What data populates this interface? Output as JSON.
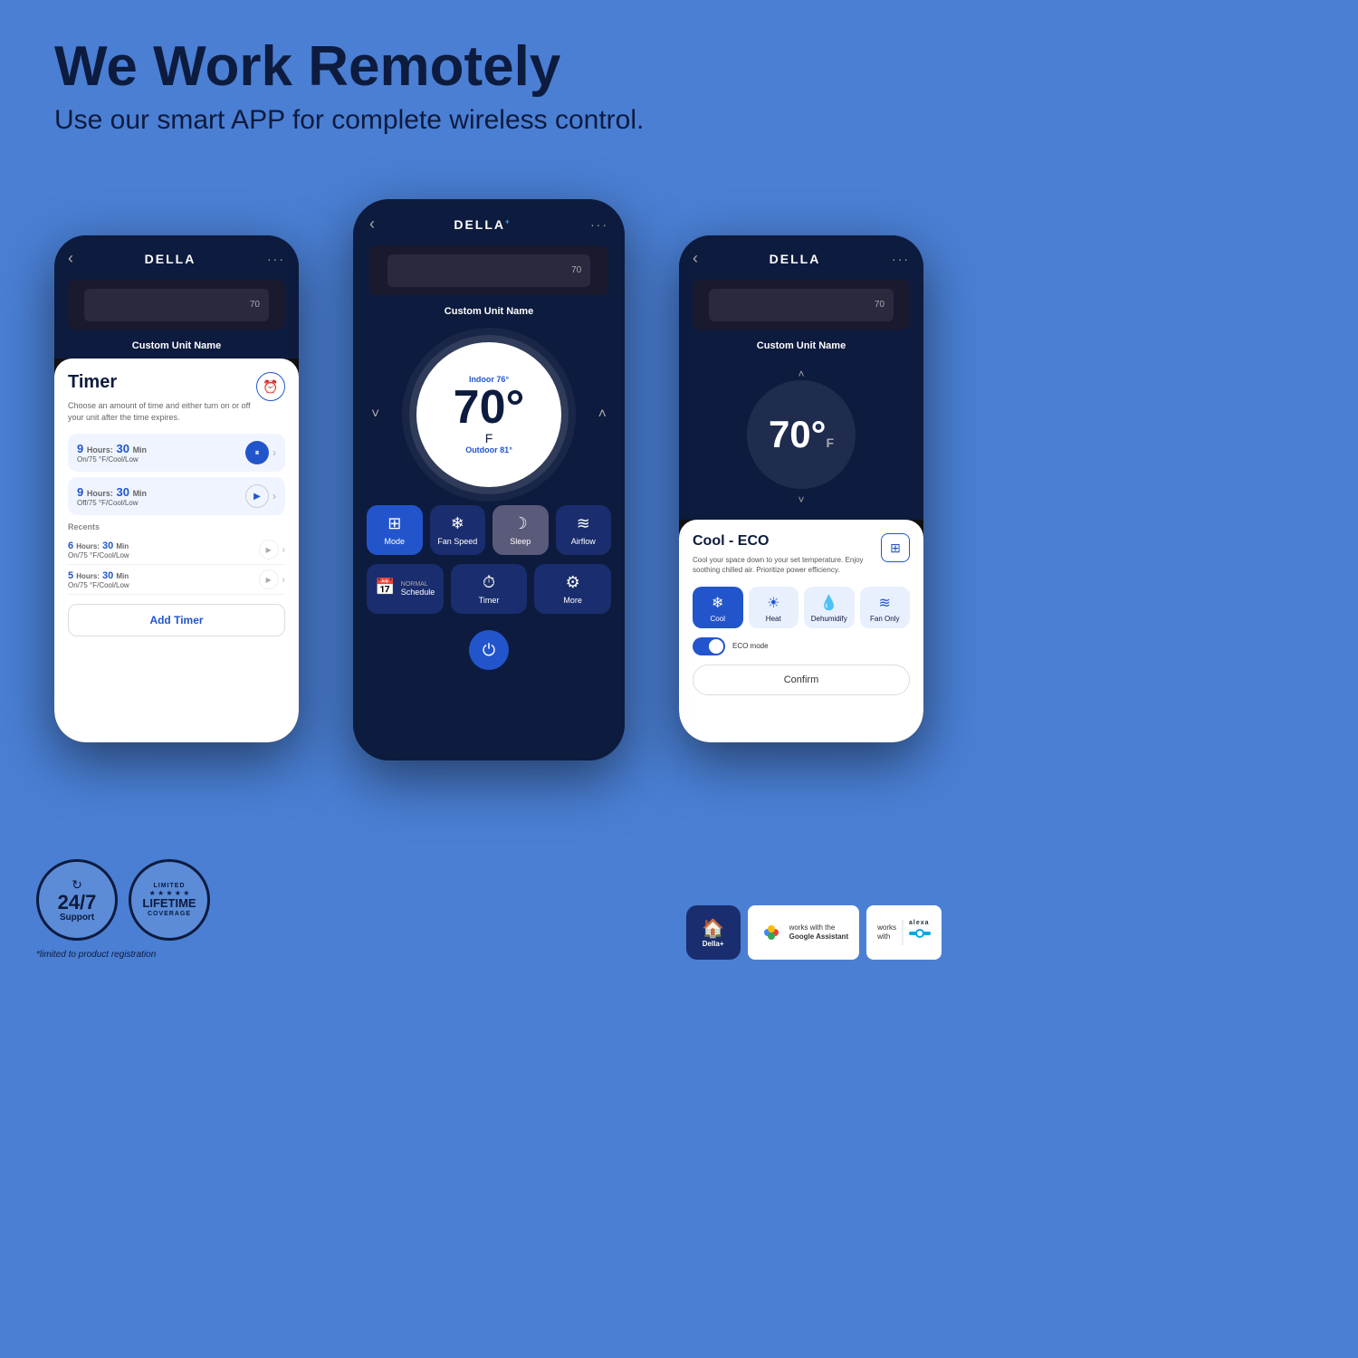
{
  "header": {
    "title": "We Work Remotely",
    "subtitle": "Use our smart APP for complete wireless control."
  },
  "left_phone": {
    "brand": "DELLA",
    "unit_name": "Custom Unit Name",
    "screen": "timer",
    "timer_title": "Timer",
    "timer_desc": "Choose an amount of time and either turn on or off your unit after the time expires.",
    "timers": [
      {
        "hours": "9",
        "hours_label": "Hours:",
        "mins": "30",
        "mins_label": "Min",
        "sub": "On/75 °F/Cool/Low",
        "active": true
      },
      {
        "hours": "9",
        "hours_label": "Hours:",
        "mins": "30",
        "mins_label": "Min",
        "sub": "Off/75 °F/Cool/Low",
        "active": false
      }
    ],
    "recents_label": "Recents",
    "recents": [
      {
        "hours": "6",
        "hours_label": "Hours:",
        "mins": "30",
        "mins_label": "Min",
        "sub": "On/75 °F/Cool/Low"
      },
      {
        "hours": "5",
        "hours_label": "Hours:",
        "mins": "30",
        "mins_label": "Min",
        "sub": "On/75 °F/Cool/Low"
      }
    ],
    "add_timer_label": "Add Timer"
  },
  "center_phone": {
    "brand": "DELLA",
    "unit_name": "Custom Unit Name",
    "indoor_label": "Indoor 76°",
    "temp": "70°",
    "temp_unit": "F",
    "outdoor_label": "Outdoor 81°",
    "modes": [
      {
        "label": "Mode",
        "icon": "⊞"
      },
      {
        "label": "Fan Speed",
        "icon": "❄"
      },
      {
        "label": "Sleep",
        "icon": "☾"
      },
      {
        "label": "Airflow",
        "icon": "≋"
      }
    ],
    "bottom_buttons": [
      {
        "label": "Schedule",
        "sublabel": "NORMAL",
        "icon": "📅"
      },
      {
        "label": "Timer",
        "icon": "⏱"
      },
      {
        "label": "More",
        "icon": "⚙"
      }
    ]
  },
  "right_phone": {
    "brand": "DELLA",
    "unit_name": "Custom Unit Name",
    "temp": "70°",
    "temp_unit": "F",
    "screen": "cool_eco",
    "eco_title": "Cool - ECO",
    "eco_desc": "Cool your space down to your set temperature. Enjoy soothing chilled air. Prioritize power efficiency.",
    "mode_buttons": [
      {
        "label": "Cool",
        "active": true
      },
      {
        "label": "Heat",
        "active": false
      },
      {
        "label": "Dehumidify",
        "active": false
      },
      {
        "label": "Fan Only",
        "active": false
      }
    ],
    "eco_mode_label": "ECO mode",
    "confirm_label": "Confirm"
  },
  "bottom": {
    "support_number": "24/7",
    "support_label": "Support",
    "lifetime_limited": "LIMITED",
    "lifetime_stars": "★ ★ ★ ★ ★",
    "lifetime_main": "LIFETIME",
    "lifetime_coverage": "COVERAGE",
    "limited_note": "*limited to product registration",
    "della_plus_label": "Della+",
    "google_line1": "works with the",
    "google_line2": "Google Assistant",
    "alexa_line1": "works",
    "alexa_line2": "with",
    "alexa_logo": "alexa"
  }
}
